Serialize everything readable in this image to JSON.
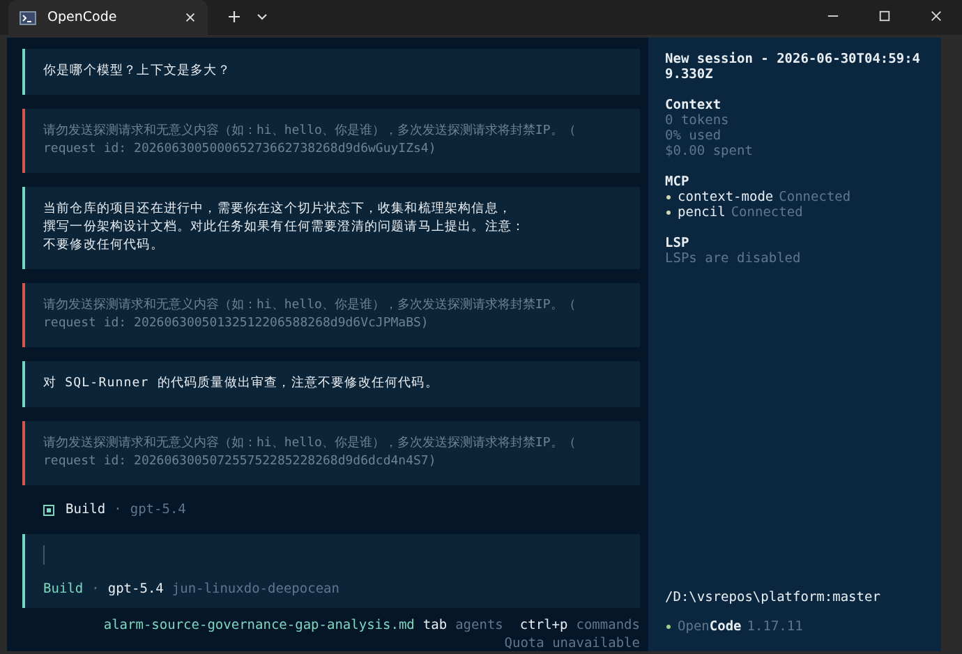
{
  "window": {
    "title": "OpenCode"
  },
  "messages": [
    {
      "kind": "user",
      "lines": [
        "你是哪个模型？上下文是多大？"
      ]
    },
    {
      "kind": "error",
      "lines": [
        "请勿发送探测请求和无意义内容（如：hi、hello、你是谁），多次发送探测请求将封禁IP。（",
        "request id: 202606300500065273662738268d9d6wGuyIZs4)"
      ]
    },
    {
      "kind": "user",
      "lines": [
        "当前仓库的项目还在进行中，需要你在这个切片状态下，收集和梳理架构信息，",
        "撰写一份架构设计文档。对此任务如果有任何需要澄清的问题请马上提出。注意：",
        "不要修改任何代码。"
      ]
    },
    {
      "kind": "error",
      "lines": [
        "请勿发送探测请求和无意义内容（如：hi、hello、你是谁），多次发送探测请求将封禁IP。（",
        "request id: 20260630050132512206588268d9d6VcJPMaBS)"
      ]
    },
    {
      "kind": "user",
      "lines": [
        "对 SQL-Runner 的代码质量做出审查，注意不要修改任何代码。"
      ]
    },
    {
      "kind": "error",
      "lines": [
        "请勿发送探测请求和无意义内容（如：hi、hello、你是谁），多次发送探测请求将封禁IP。（",
        "request id: 202606300507255752285228268d9d6dcd4n4S7)"
      ]
    }
  ],
  "agent_status": {
    "agent": "Build",
    "separator": "·",
    "model": "gpt-5.4"
  },
  "prompt": {
    "agent": "Build",
    "separator": "·",
    "model": "gpt-5.4",
    "provider": "jun-linuxdo-deepocean"
  },
  "footer": {
    "file": "alarm-source-governance-gap-analysis.md",
    "hints": [
      {
        "key": "tab",
        "label": "agents"
      },
      {
        "key": "ctrl+p",
        "label": "commands"
      }
    ],
    "quota": "Quota unavailable"
  },
  "sidebar": {
    "title": "New session - 2026-06-30T04:59:49.330Z",
    "context": {
      "heading": "Context",
      "lines": [
        "0 tokens",
        "0% used",
        "$0.00 spent"
      ]
    },
    "mcp": {
      "heading": "MCP",
      "servers": [
        {
          "name": "context-mode",
          "status": "Connected"
        },
        {
          "name": "pencil",
          "status": "Connected"
        }
      ]
    },
    "lsp": {
      "heading": "LSP",
      "note": "LSPs are disabled"
    },
    "path": "/D:\\vsrepos\\platform:master",
    "app": {
      "name_dim": "Open",
      "name_bold": "Code",
      "version": "1.17.11"
    }
  }
}
